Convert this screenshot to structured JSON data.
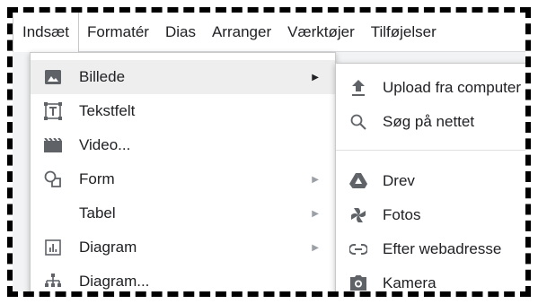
{
  "menubar": {
    "items": [
      {
        "label": "Indsæt",
        "active": true
      },
      {
        "label": "Formatér"
      },
      {
        "label": "Dias"
      },
      {
        "label": "Arranger"
      },
      {
        "label": "Værktøjer"
      },
      {
        "label": "Tilføjelser"
      }
    ]
  },
  "insert_menu": {
    "items": [
      {
        "label": "Billede",
        "icon": "image-icon",
        "has_submenu": true,
        "highlighted": true
      },
      {
        "label": "Tekstfelt",
        "icon": "textbox-icon"
      },
      {
        "label": "Video...",
        "icon": "video-icon"
      },
      {
        "label": "Form",
        "icon": "shape-icon",
        "has_submenu": true
      },
      {
        "label": "Tabel",
        "icon": "",
        "has_submenu": true
      },
      {
        "label": "Diagram",
        "icon": "chart-icon",
        "has_submenu": true
      },
      {
        "label": "Diagram...",
        "icon": "org-chart-icon"
      }
    ]
  },
  "image_submenu": {
    "items": [
      {
        "label": "Upload fra computer",
        "icon": "upload-icon"
      },
      {
        "label": "Søg på nettet",
        "icon": "search-icon"
      },
      {
        "label": "Drev",
        "icon": "drive-icon"
      },
      {
        "label": "Fotos",
        "icon": "photos-icon"
      },
      {
        "label": "Efter webadresse",
        "icon": "link-icon"
      },
      {
        "label": "Kamera",
        "icon": "camera-icon"
      }
    ]
  },
  "colors": {
    "text": "#202124",
    "icon": "#5f6368",
    "highlight": "#eeeeee",
    "border": "#c9c9c9"
  }
}
